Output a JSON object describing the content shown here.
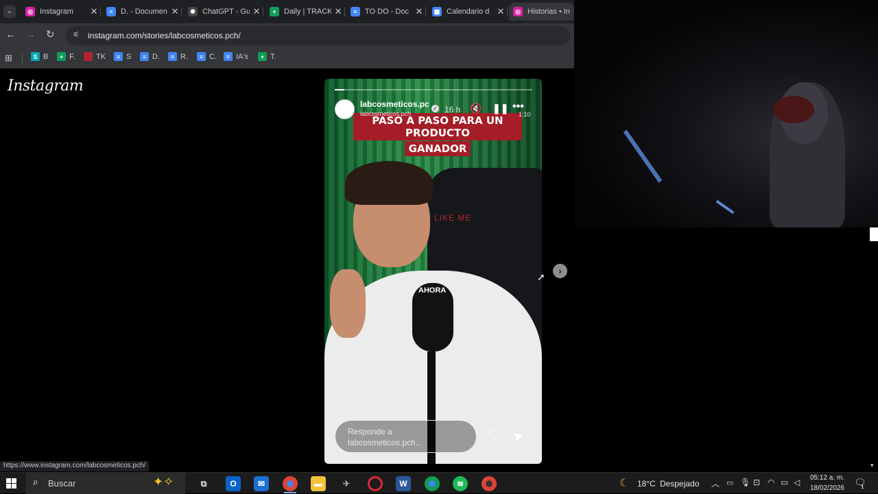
{
  "browser": {
    "tabs": [
      {
        "title": "Instagram",
        "icon": "instagram-icon",
        "color": "#d6249f",
        "letter": "◎"
      },
      {
        "title": "D. - Documen",
        "icon": "docs-icon",
        "color": "#4285f4",
        "letter": "≡"
      },
      {
        "title": "ChatGPT - Gu",
        "icon": "chatgpt-icon",
        "color": "#444",
        "letter": "✺"
      },
      {
        "title": "Daily | TRACK",
        "icon": "sheets-icon",
        "color": "#0f9d58",
        "letter": "+"
      },
      {
        "title": "TO DO - Doc",
        "icon": "docs-icon",
        "color": "#4285f4",
        "letter": "≡"
      },
      {
        "title": "Calendario d",
        "icon": "calendar-icon",
        "color": "#4285f4",
        "letter": "▦"
      },
      {
        "title": "Historias • In",
        "icon": "instagram-icon",
        "color": "#d6249f",
        "letter": "◎"
      }
    ],
    "url": "instagram.com/stories/labcosmeticos.pch/",
    "bookmarks": [
      {
        "label": "B",
        "icon": "bookmark-b-icon",
        "color": "#00a7b5",
        "letter": "S"
      },
      {
        "label": "F.",
        "icon": "sheets-icon",
        "color": "#0f9d58",
        "letter": "+"
      },
      {
        "label": "TK",
        "icon": "flag-icon",
        "color": "#b22234",
        "letter": ""
      },
      {
        "label": "S",
        "icon": "docs-icon",
        "color": "#4285f4",
        "letter": "≡"
      },
      {
        "label": "D.",
        "icon": "docs-icon",
        "color": "#4285f4",
        "letter": "≡"
      },
      {
        "label": "R.",
        "icon": "docs-icon",
        "color": "#4285f4",
        "letter": "≡"
      },
      {
        "label": "C.",
        "icon": "docs-icon",
        "color": "#4285f4",
        "letter": "≡"
      },
      {
        "label": "IA's",
        "icon": "docs-icon",
        "color": "#4285f4",
        "letter": "≡"
      },
      {
        "label": "T.",
        "icon": "sheets-icon",
        "color": "#0f9d58",
        "letter": "+"
      }
    ],
    "status_url": "https://www.instagram.com/labcosmeticos.pch/"
  },
  "instagram": {
    "logo": "Instagram",
    "story": {
      "username": "labcosmeticos.pc",
      "subline": "labcosmeticos.pch",
      "time": "16 h",
      "duration": "1:10",
      "caption_line1": "PASO A PASO PARA UN PRODUCTO",
      "caption_line2": "GANADOR",
      "overlay_word": "AHORA",
      "chair_text": "LIKE ME",
      "reply_placeholder_line1": "Responde a",
      "reply_placeholder_line2": "labcosmeticos.pch...",
      "progress": 0.04
    }
  },
  "taskbar": {
    "search_label": "Buscar",
    "weather_temp": "18°C",
    "weather_desc": "Despejado",
    "clock_time": "05:12 a. m.",
    "clock_date": "18/02/2026",
    "notifications": "1"
  }
}
